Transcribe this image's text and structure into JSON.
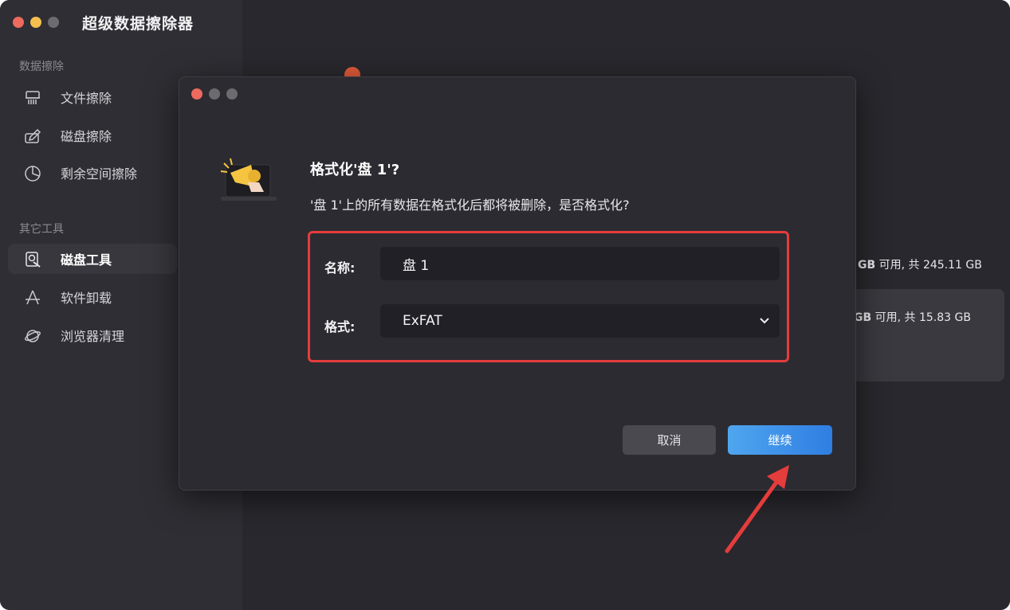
{
  "app": {
    "title": "超级数据擦除器"
  },
  "sidebar": {
    "sections": [
      {
        "label": "数据擦除",
        "items": [
          {
            "label": "文件擦除",
            "icon": "shredder-icon"
          },
          {
            "label": "磁盘擦除",
            "icon": "disk-erase-icon"
          },
          {
            "label": "剩余空间擦除",
            "icon": "pie-chart-icon"
          }
        ]
      },
      {
        "label": "其它工具",
        "items": [
          {
            "label": "磁盘工具",
            "icon": "disk-tool-icon",
            "active": true
          },
          {
            "label": "软件卸载",
            "icon": "app-uninstall-icon"
          },
          {
            "label": "浏览器清理",
            "icon": "planet-icon"
          }
        ]
      }
    ]
  },
  "disks": [
    {
      "free_bold": "GB",
      "rest": " 可用, 共 245.11 GB"
    },
    {
      "free_bold": "GB",
      "rest": " 可用, 共 15.83 GB"
    }
  ],
  "dialog": {
    "title": "格式化'盘 1'?",
    "message": "'盘 1'上的所有数据在格式化后都将被删除，是否格式化?",
    "name_label": "名称:",
    "name_value": "盘 1",
    "format_label": "格式:",
    "format_value": "ExFAT",
    "cancel_label": "取消",
    "continue_label": "继续"
  },
  "colors": {
    "accent": "#2f7ee2",
    "highlight": "#e53c3c",
    "close": "#ed6a5e",
    "minimize": "#f4bf4f"
  }
}
